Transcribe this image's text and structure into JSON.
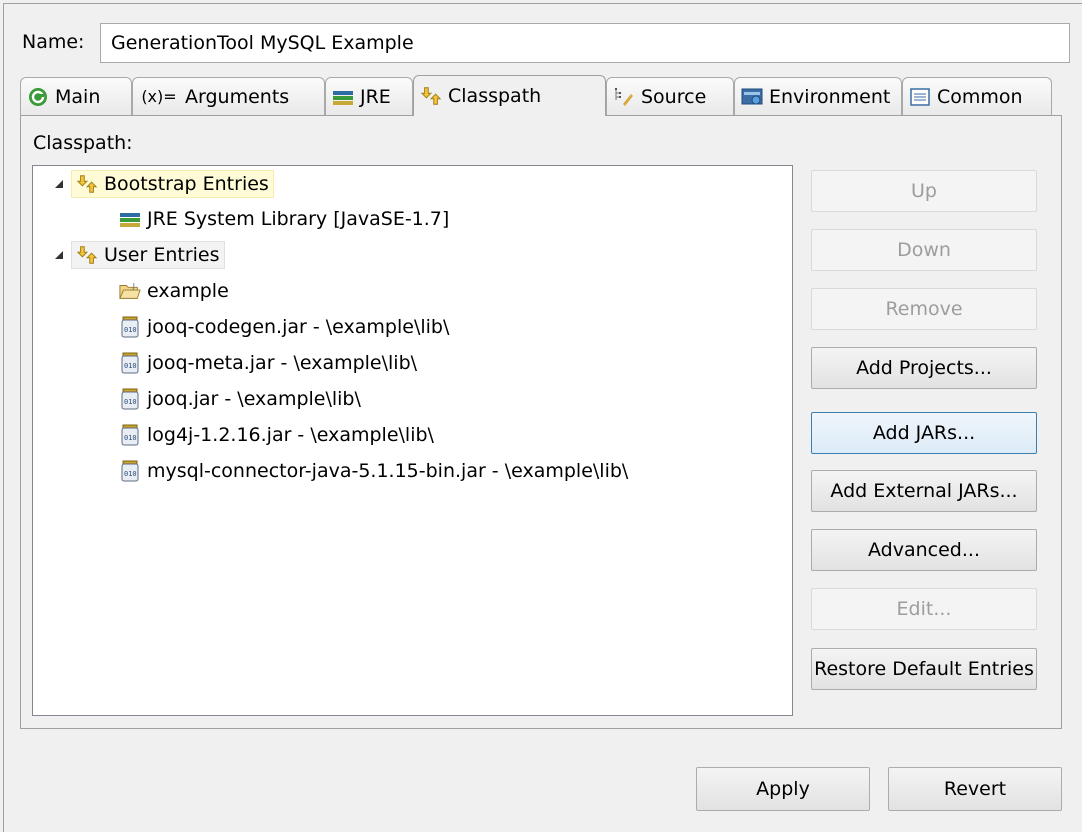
{
  "name": {
    "label": "Name:",
    "value": "GenerationTool MySQL Example"
  },
  "tabs": [
    {
      "label": "Main",
      "icon": "main-tab-icon"
    },
    {
      "label": "Arguments",
      "icon": "arguments-tab-icon"
    },
    {
      "label": "JRE",
      "icon": "jre-tab-icon"
    },
    {
      "label": "Classpath",
      "icon": "classpath-tab-icon",
      "active": true
    },
    {
      "label": "Source",
      "icon": "source-tab-icon"
    },
    {
      "label": "Environment",
      "icon": "environment-tab-icon"
    },
    {
      "label": "Common",
      "icon": "common-tab-icon"
    }
  ],
  "classpath": {
    "label": "Classpath:",
    "tree": {
      "bootstrap": {
        "label": "Bootstrap Entries",
        "children": [
          "JRE System Library [JavaSE-1.7]"
        ]
      },
      "user": {
        "label": "User Entries",
        "children": [
          "example",
          "jooq-codegen.jar - \\example\\lib\\",
          "jooq-meta.jar - \\example\\lib\\",
          "jooq.jar - \\example\\lib\\",
          "log4j-1.2.16.jar - \\example\\lib\\",
          "mysql-connector-java-5.1.15-bin.jar - \\example\\lib\\"
        ]
      }
    },
    "buttons": {
      "up": "Up",
      "down": "Down",
      "remove": "Remove",
      "add_projects": "Add Projects...",
      "add_jars": "Add JARs...",
      "add_external_jars": "Add External JARs...",
      "advanced": "Advanced...",
      "edit": "Edit...",
      "restore": "Restore Default Entries"
    }
  },
  "footer": {
    "apply": "Apply",
    "revert": "Revert"
  },
  "colors": {
    "selection_highlight": "#fffbd6",
    "focus_border": "#3c7fb1",
    "disabled_text": "#9d9d9d"
  }
}
